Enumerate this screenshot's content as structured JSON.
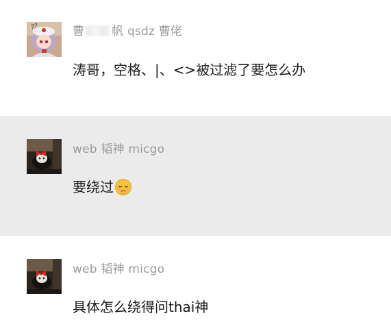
{
  "messages": [
    {
      "sender_prefix": "曹",
      "sender_redacted": true,
      "sender_suffix": "帆 qsdz 曹佬",
      "text": "涛哥，空格、|、<>被过滤了要怎么办",
      "avatar_icon": "anime-girl-avatar-icon"
    },
    {
      "sender": "web 韬神 micgo",
      "text": "要绕过",
      "emoji_icon": "pensive-face-emoji-icon",
      "avatar_icon": "dark-photo-avatar-icon"
    },
    {
      "sender": "web 韬神 micgo",
      "text": "具体怎么绕得问thai神",
      "avatar_icon": "dark-photo-avatar-icon"
    }
  ],
  "colors": {
    "highlight_background": "#ebebeb",
    "sender_text": "#9a9a9a",
    "message_text": "#1a1a1a"
  }
}
